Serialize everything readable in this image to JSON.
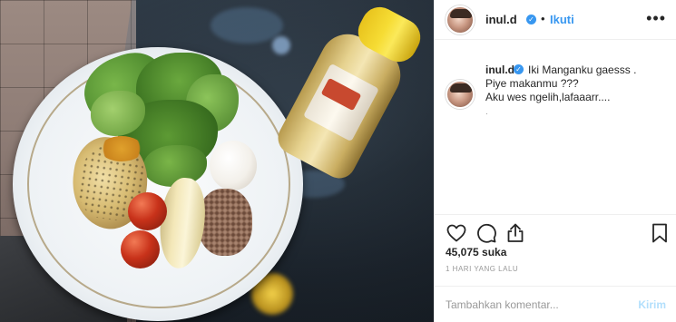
{
  "post": {
    "username": "inul.d",
    "follow_label": "Ikuti",
    "dot_separator": "•",
    "more_label": "•••",
    "verified_glyph": "✓"
  },
  "caption": {
    "username": "inul.d",
    "lines": [
      "Iki Manganku gaesss .",
      "Piye makanmu ???",
      "Aku wes ngelih,lafaaarr....",
      "."
    ]
  },
  "actions": {
    "icons": [
      "heart-icon",
      "comment-icon",
      "share-icon",
      "bookmark-icon"
    ]
  },
  "likes_text": "45,075 suka",
  "timestamp": "1 HARI YANG LALU",
  "comment": {
    "placeholder": "Tambahkan komentar...",
    "post_label": "Kirim"
  },
  "colors": {
    "accent": "#3897f0",
    "post_disabled": "#b2dffc",
    "text": "#262626",
    "muted": "#999999",
    "border": "#efefef"
  }
}
